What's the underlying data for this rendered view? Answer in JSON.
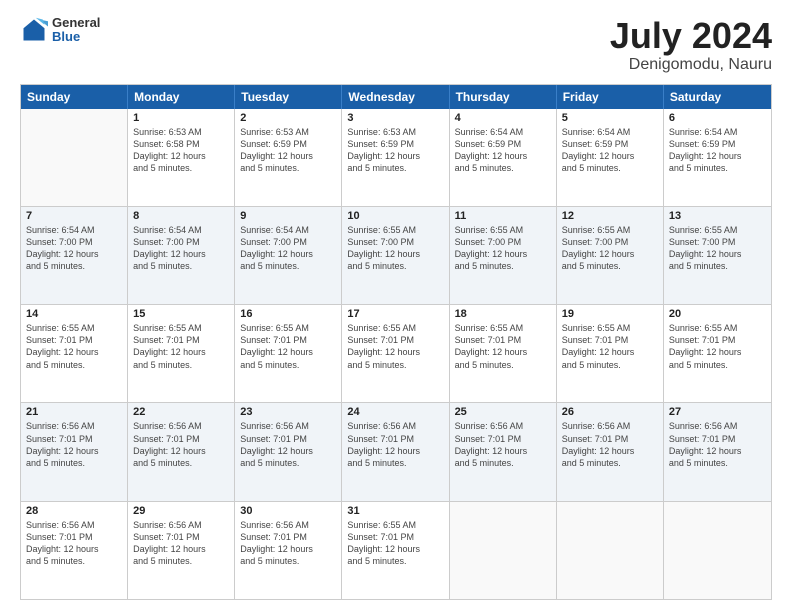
{
  "logo": {
    "general": "General",
    "blue": "Blue"
  },
  "title": {
    "month": "July 2024",
    "location": "Denigomodu, Nauru"
  },
  "header_days": [
    "Sunday",
    "Monday",
    "Tuesday",
    "Wednesday",
    "Thursday",
    "Friday",
    "Saturday"
  ],
  "weeks": [
    [
      {
        "day": "",
        "info": ""
      },
      {
        "day": "1",
        "info": "Sunrise: 6:53 AM\nSunset: 6:58 PM\nDaylight: 12 hours\nand 5 minutes."
      },
      {
        "day": "2",
        "info": "Sunrise: 6:53 AM\nSunset: 6:59 PM\nDaylight: 12 hours\nand 5 minutes."
      },
      {
        "day": "3",
        "info": "Sunrise: 6:53 AM\nSunset: 6:59 PM\nDaylight: 12 hours\nand 5 minutes."
      },
      {
        "day": "4",
        "info": "Sunrise: 6:54 AM\nSunset: 6:59 PM\nDaylight: 12 hours\nand 5 minutes."
      },
      {
        "day": "5",
        "info": "Sunrise: 6:54 AM\nSunset: 6:59 PM\nDaylight: 12 hours\nand 5 minutes."
      },
      {
        "day": "6",
        "info": "Sunrise: 6:54 AM\nSunset: 6:59 PM\nDaylight: 12 hours\nand 5 minutes."
      }
    ],
    [
      {
        "day": "7",
        "info": "Sunrise: 6:54 AM\nSunset: 7:00 PM\nDaylight: 12 hours\nand 5 minutes."
      },
      {
        "day": "8",
        "info": "Sunrise: 6:54 AM\nSunset: 7:00 PM\nDaylight: 12 hours\nand 5 minutes."
      },
      {
        "day": "9",
        "info": "Sunrise: 6:54 AM\nSunset: 7:00 PM\nDaylight: 12 hours\nand 5 minutes."
      },
      {
        "day": "10",
        "info": "Sunrise: 6:55 AM\nSunset: 7:00 PM\nDaylight: 12 hours\nand 5 minutes."
      },
      {
        "day": "11",
        "info": "Sunrise: 6:55 AM\nSunset: 7:00 PM\nDaylight: 12 hours\nand 5 minutes."
      },
      {
        "day": "12",
        "info": "Sunrise: 6:55 AM\nSunset: 7:00 PM\nDaylight: 12 hours\nand 5 minutes."
      },
      {
        "day": "13",
        "info": "Sunrise: 6:55 AM\nSunset: 7:00 PM\nDaylight: 12 hours\nand 5 minutes."
      }
    ],
    [
      {
        "day": "14",
        "info": "Sunrise: 6:55 AM\nSunset: 7:01 PM\nDaylight: 12 hours\nand 5 minutes."
      },
      {
        "day": "15",
        "info": "Sunrise: 6:55 AM\nSunset: 7:01 PM\nDaylight: 12 hours\nand 5 minutes."
      },
      {
        "day": "16",
        "info": "Sunrise: 6:55 AM\nSunset: 7:01 PM\nDaylight: 12 hours\nand 5 minutes."
      },
      {
        "day": "17",
        "info": "Sunrise: 6:55 AM\nSunset: 7:01 PM\nDaylight: 12 hours\nand 5 minutes."
      },
      {
        "day": "18",
        "info": "Sunrise: 6:55 AM\nSunset: 7:01 PM\nDaylight: 12 hours\nand 5 minutes."
      },
      {
        "day": "19",
        "info": "Sunrise: 6:55 AM\nSunset: 7:01 PM\nDaylight: 12 hours\nand 5 minutes."
      },
      {
        "day": "20",
        "info": "Sunrise: 6:55 AM\nSunset: 7:01 PM\nDaylight: 12 hours\nand 5 minutes."
      }
    ],
    [
      {
        "day": "21",
        "info": "Sunrise: 6:56 AM\nSunset: 7:01 PM\nDaylight: 12 hours\nand 5 minutes."
      },
      {
        "day": "22",
        "info": "Sunrise: 6:56 AM\nSunset: 7:01 PM\nDaylight: 12 hours\nand 5 minutes."
      },
      {
        "day": "23",
        "info": "Sunrise: 6:56 AM\nSunset: 7:01 PM\nDaylight: 12 hours\nand 5 minutes."
      },
      {
        "day": "24",
        "info": "Sunrise: 6:56 AM\nSunset: 7:01 PM\nDaylight: 12 hours\nand 5 minutes."
      },
      {
        "day": "25",
        "info": "Sunrise: 6:56 AM\nSunset: 7:01 PM\nDaylight: 12 hours\nand 5 minutes."
      },
      {
        "day": "26",
        "info": "Sunrise: 6:56 AM\nSunset: 7:01 PM\nDaylight: 12 hours\nand 5 minutes."
      },
      {
        "day": "27",
        "info": "Sunrise: 6:56 AM\nSunset: 7:01 PM\nDaylight: 12 hours\nand 5 minutes."
      }
    ],
    [
      {
        "day": "28",
        "info": "Sunrise: 6:56 AM\nSunset: 7:01 PM\nDaylight: 12 hours\nand 5 minutes."
      },
      {
        "day": "29",
        "info": "Sunrise: 6:56 AM\nSunset: 7:01 PM\nDaylight: 12 hours\nand 5 minutes."
      },
      {
        "day": "30",
        "info": "Sunrise: 6:56 AM\nSunset: 7:01 PM\nDaylight: 12 hours\nand 5 minutes."
      },
      {
        "day": "31",
        "info": "Sunrise: 6:55 AM\nSunset: 7:01 PM\nDaylight: 12 hours\nand 5 minutes."
      },
      {
        "day": "",
        "info": ""
      },
      {
        "day": "",
        "info": ""
      },
      {
        "day": "",
        "info": ""
      }
    ]
  ]
}
